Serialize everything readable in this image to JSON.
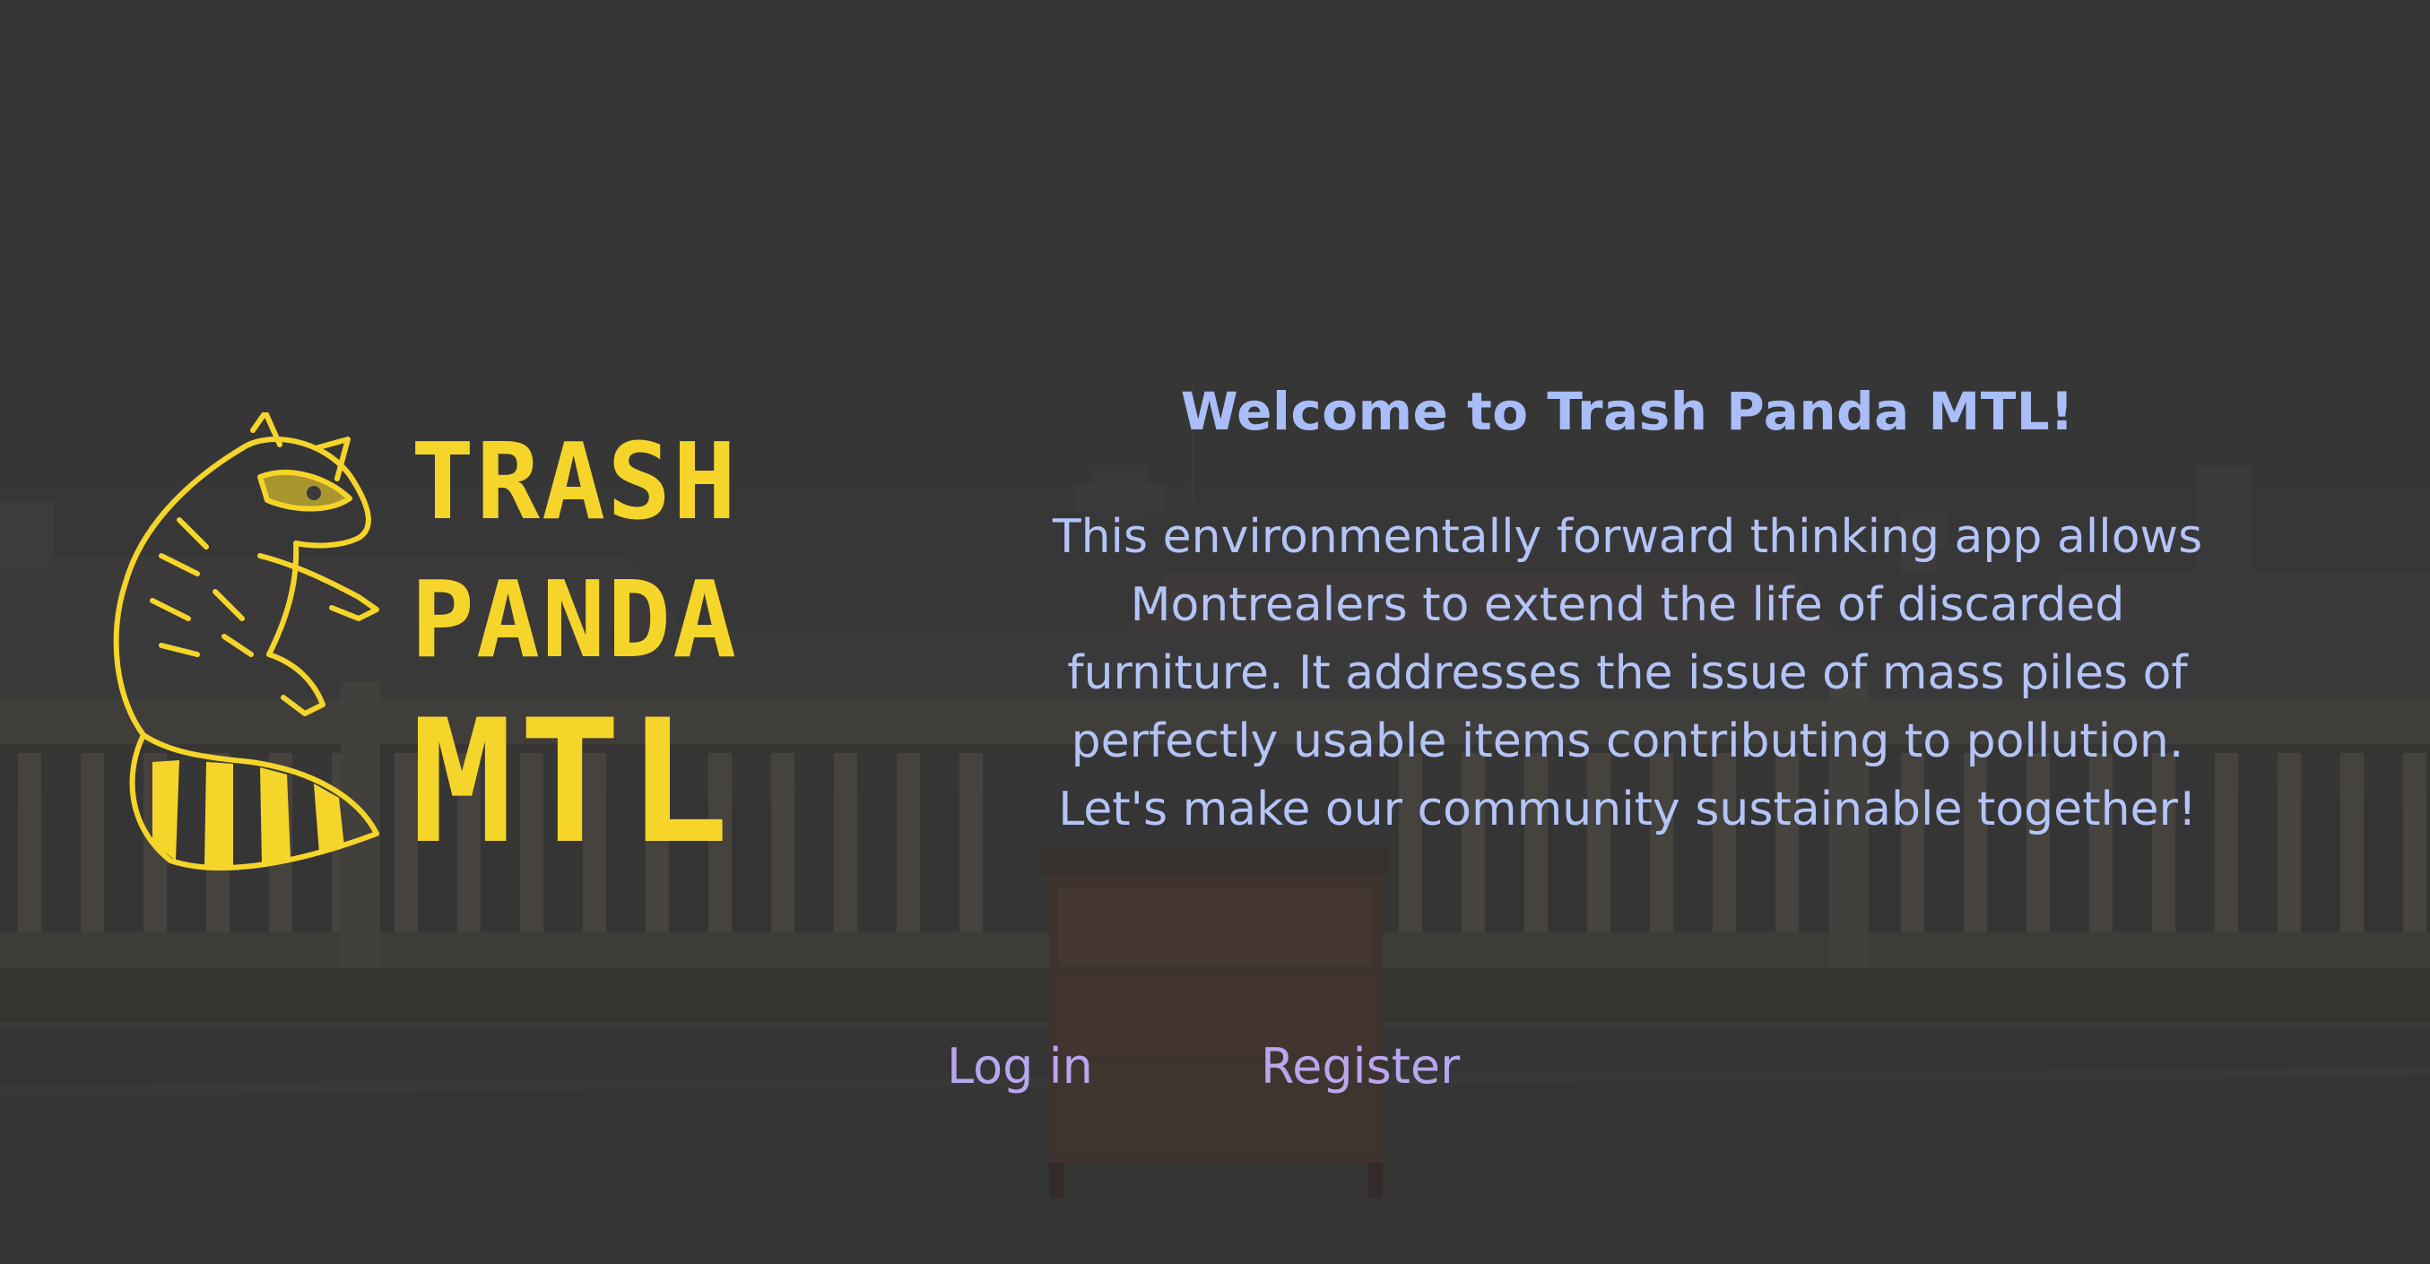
{
  "brand": {
    "logo_lines": [
      "TRASH",
      "PANDA",
      "MTL"
    ],
    "logo_color": "#f6d52a",
    "mascot_icon": "raccoon-icon"
  },
  "welcome": {
    "title": "Welcome to Trash Panda MTL!",
    "body_lines": [
      "This environmentally forward thinking app allows",
      "Montrealers to extend the life of discarded",
      "furniture. It addresses the issue of mass piles of",
      "perfectly usable items contributing to pollution.",
      "Let's make our community sustainable together!"
    ],
    "text_color": "#a9bdf8"
  },
  "auth": {
    "login_label": "Log in",
    "register_label": "Register",
    "link_color": "#b9a6ef"
  }
}
